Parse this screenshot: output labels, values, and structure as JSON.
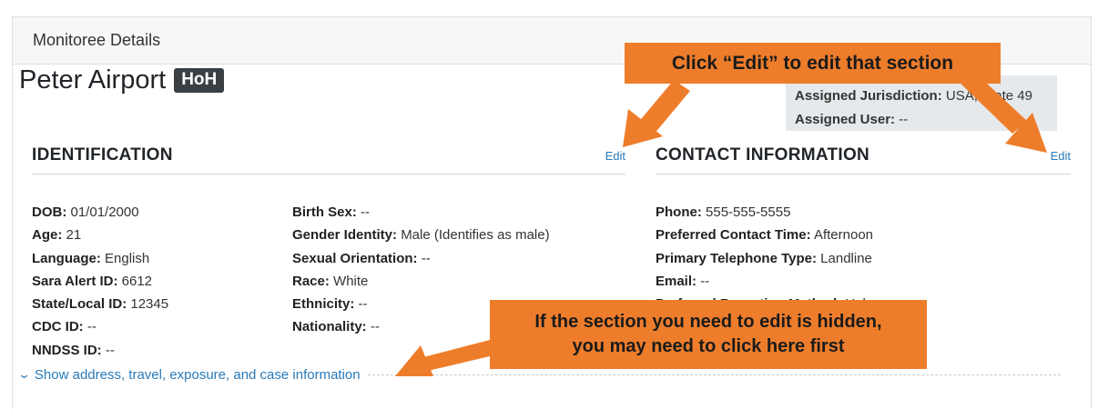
{
  "card": {
    "title": "Monitoree Details"
  },
  "patient": {
    "name": "Peter Airport",
    "badge": "HoH"
  },
  "assignment": {
    "jurisdiction_label": "Assigned Jurisdiction:",
    "jurisdiction_value": "USA, State 49",
    "user_label": "Assigned User:",
    "user_value": "--"
  },
  "identification": {
    "title": "IDENTIFICATION",
    "edit_label": "Edit",
    "col1": [
      {
        "label": "DOB:",
        "value": "01/01/2000"
      },
      {
        "label": "Age:",
        "value": "21"
      },
      {
        "label": "Language:",
        "value": "English"
      },
      {
        "label": "Sara Alert ID:",
        "value": "6612"
      },
      {
        "label": "State/Local ID:",
        "value": "12345"
      },
      {
        "label": "CDC ID:",
        "value": "--"
      },
      {
        "label": "NNDSS ID:",
        "value": "--"
      }
    ],
    "col2": [
      {
        "label": "Birth Sex:",
        "value": "--"
      },
      {
        "label": "Gender Identity:",
        "value": "Male (Identifies as male)"
      },
      {
        "label": "Sexual Orientation:",
        "value": "--"
      },
      {
        "label": "Race:",
        "value": "White"
      },
      {
        "label": "Ethnicity:",
        "value": "--"
      },
      {
        "label": "Nationality:",
        "value": "--"
      }
    ]
  },
  "contact": {
    "title": "CONTACT INFORMATION",
    "edit_label": "Edit",
    "fields": [
      {
        "label": "Phone:",
        "value": "555-555-5555"
      },
      {
        "label": "Preferred Contact Time:",
        "value": "Afternoon"
      },
      {
        "label": "Primary Telephone Type:",
        "value": "Landline"
      },
      {
        "label": "Email:",
        "value": "--"
      },
      {
        "label": "Preferred Reporting Method:",
        "value": "Unknown"
      }
    ]
  },
  "show_more": {
    "label": "Show address, travel, exposure, and case information"
  },
  "callouts": {
    "edit": "Click “Edit” to edit that section",
    "hidden_line1": "If the section you need to edit is hidden,",
    "hidden_line2": "you may need to click here first"
  },
  "colors": {
    "callout": "#ee7d2b",
    "link": "#2a7ab8",
    "badge": "#3a3f44"
  }
}
